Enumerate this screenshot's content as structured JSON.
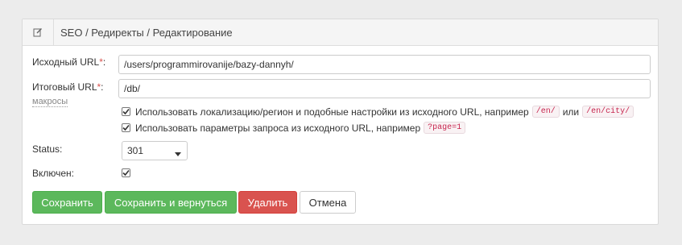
{
  "header": {
    "title": "SEO / Редиректы / Редактирование",
    "icon": "edit-icon"
  },
  "form": {
    "source_url": {
      "label": "Исходный URL",
      "required_mark": "*",
      "colon": ":",
      "value": "/users/programmirovanije/bazy-dannyh/"
    },
    "target_url": {
      "label": "Итоговый URL",
      "required_mark": "*",
      "colon": ":",
      "value": "/db/",
      "macros_link": "макросы"
    },
    "options": {
      "use_localization": {
        "checked": true,
        "text": "Использовать локализацию/регион и подобные настройки из исходного URL, например",
        "example1": "/en/",
        "or": "или",
        "example2": "/en/city/"
      },
      "use_query": {
        "checked": true,
        "text": "Использовать параметры запроса из исходного URL, например",
        "example": "?page=1"
      }
    },
    "status": {
      "label": "Status:",
      "value": "301"
    },
    "enabled": {
      "label": "Включен:",
      "checked": true
    }
  },
  "buttons": {
    "save": "Сохранить",
    "save_return": "Сохранить и вернуться",
    "delete": "Удалить",
    "cancel": "Отмена"
  },
  "colors": {
    "success": "#5cb85c",
    "danger": "#d9534f",
    "required": "#d9534f"
  }
}
